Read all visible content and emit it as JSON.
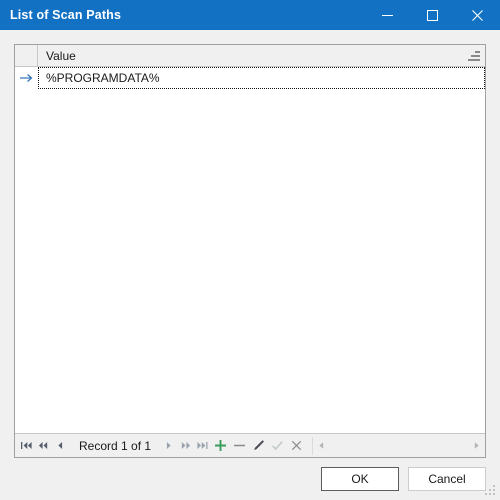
{
  "window": {
    "title": "List of Scan Paths",
    "titlebar_color": "#1371c3",
    "background_color": "#f0f0f0",
    "controls": {
      "minimize": "minimize",
      "maximize": "maximize",
      "close": "close"
    }
  },
  "grid": {
    "columns": [
      {
        "key": "indicator",
        "label": ""
      },
      {
        "key": "value",
        "label": "Value"
      }
    ],
    "header_menu_icon": "column-options-icon",
    "rows": [
      {
        "indicator": "current-row-arrow",
        "value": "%PROGRAMDATA%",
        "selected": true
      }
    ]
  },
  "navigator": {
    "first_label": "first-record",
    "prior_page_label": "prior-page",
    "prior_label": "prior-record",
    "record_text": "Record 1 of 1",
    "next_label": "next-record",
    "next_page_label": "next-page",
    "last_label": "last-record",
    "insert_label": "insert-record",
    "delete_label": "delete-record",
    "edit_label": "edit-record",
    "post_label": "post-edit",
    "cancel_label": "cancel-edit",
    "colors": {
      "insert": "#3a9b5c",
      "delete": "#8a8a8a",
      "edit": "#4a4a55",
      "post": "#c2c9c4",
      "cancel": "#8a8a8a",
      "arrow_enabled": "#555f6b",
      "arrow_disabled": "#9aa3ad"
    },
    "scrollbar": {
      "left_arrow": "scroll-left",
      "right_arrow": "scroll-right"
    }
  },
  "buttons": {
    "ok": "OK",
    "cancel": "Cancel"
  },
  "resize_grip": "resize-grip"
}
